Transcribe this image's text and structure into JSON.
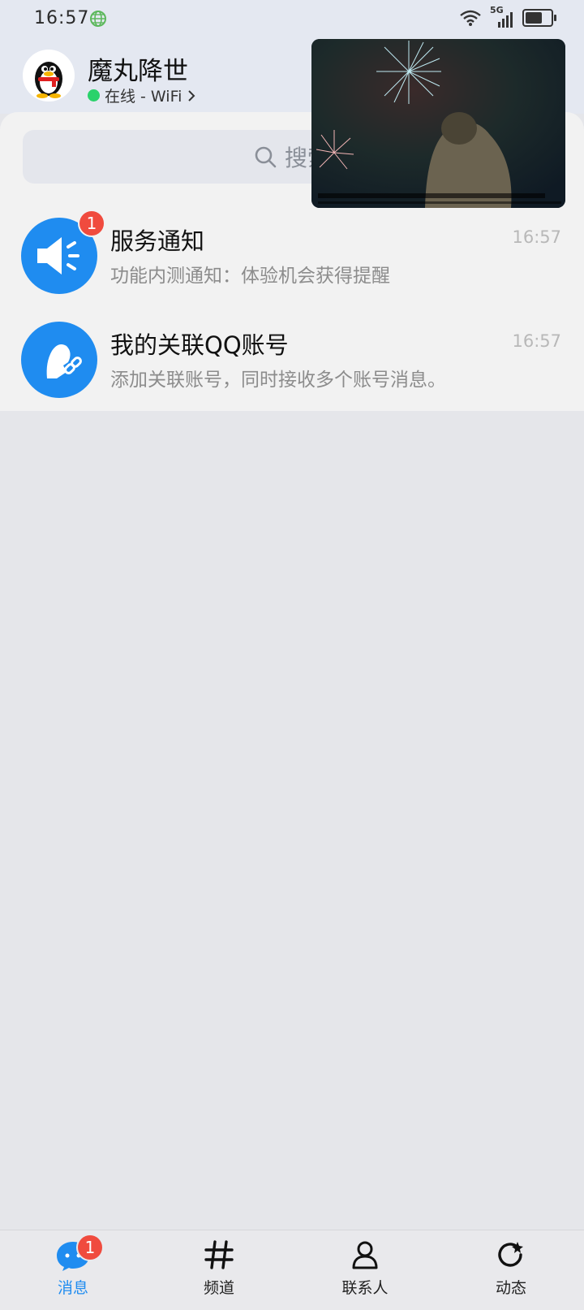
{
  "status_bar": {
    "time": "16:57",
    "network": "5G"
  },
  "profile": {
    "name": "魔丸降世",
    "presence": "在线 - WiFi"
  },
  "search": {
    "placeholder": "搜索"
  },
  "conversations": [
    {
      "title": "服务通知",
      "preview": "功能内测通知：体验机会获得提醒",
      "time": "16:57",
      "badge": "1"
    },
    {
      "title": "我的关联QQ账号",
      "preview": "添加关联账号，同时接收多个账号消息。",
      "time": "16:57",
      "badge": ""
    }
  ],
  "tabs": [
    {
      "label": "消息",
      "badge": "1"
    },
    {
      "label": "频道"
    },
    {
      "label": "联系人"
    },
    {
      "label": "动态"
    }
  ],
  "colors": {
    "accent": "#1f8cf0",
    "badge": "#f04b3e",
    "online": "#2ad26b"
  }
}
